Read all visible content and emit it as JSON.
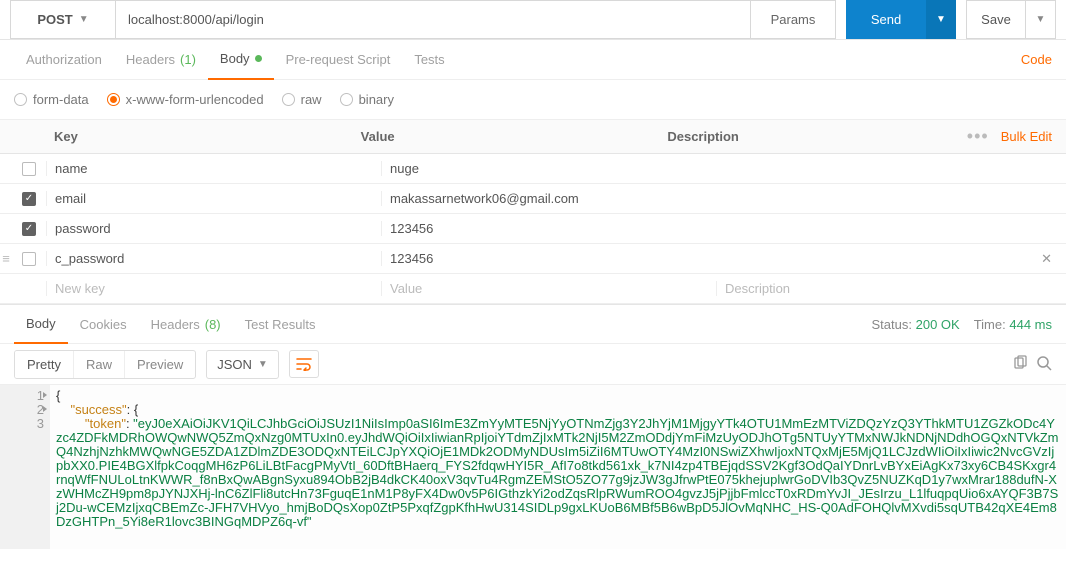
{
  "request": {
    "method": "POST",
    "url": "localhost:8000/api/login",
    "params_label": "Params",
    "send_label": "Send",
    "save_label": "Save"
  },
  "reqTabs": {
    "authorization": "Authorization",
    "headers": "Headers",
    "headers_count": "(1)",
    "body": "Body",
    "prerequest": "Pre-request Script",
    "tests": "Tests",
    "code": "Code"
  },
  "bodyType": {
    "formdata": "form-data",
    "urlencoded": "x-www-form-urlencoded",
    "raw": "raw",
    "binary": "binary"
  },
  "kvHeaders": {
    "key": "Key",
    "value": "Value",
    "description": "Description",
    "bulk": "Bulk Edit"
  },
  "rows": [
    {
      "checked": false,
      "key": "name",
      "value": "nuge",
      "desc": ""
    },
    {
      "checked": true,
      "key": "email",
      "value": "makassarnetwork06@gmail.com",
      "desc": ""
    },
    {
      "checked": true,
      "key": "password",
      "value": "123456",
      "desc": ""
    },
    {
      "checked": false,
      "key": "c_password",
      "value": "123456",
      "desc": "",
      "hover": true
    }
  ],
  "placeholders": {
    "key": "New key",
    "value": "Value",
    "desc": "Description"
  },
  "respTabs": {
    "body": "Body",
    "cookies": "Cookies",
    "headers": "Headers",
    "headers_count": "(8)",
    "tests": "Test Results"
  },
  "respMeta": {
    "status_label": "Status:",
    "status_value": "200 OK",
    "time_label": "Time:",
    "time_value": "444 ms"
  },
  "respView": {
    "pretty": "Pretty",
    "raw": "Raw",
    "preview": "Preview",
    "format": "JSON"
  },
  "json": {
    "line1": "{",
    "key_success": "\"success\"",
    "colon_brace": ": {",
    "key_token": "\"token\"",
    "colon": ": ",
    "token_value": "\"eyJ0eXAiOiJKV1QiLCJhbGciOiJSUzI1NiIsImp0aSI6ImE3ZmYyMTE5NjYyOTNmZjg3Y2JhYjM1MjgyYTk4OTU1MmEzMTViZDQzYzQ3YThkMTU1ZGZkODc4Yzc4ZDFkMDRhOWQwNWQ5ZmQxNzg0MTUxIn0.eyJhdWQiOiIxIiwianRpIjoiYTdmZjIxMTk2NjI5M2ZmODdjYmFiMzUyODJhOTg5NTUyYTMxNWJkNDNjNDdhOGQxNTVkZmQ4NzhjNzhkMWQwNGE5ZDA1ZDlmZDE3ODQxNTEiLCJpYXQiOjE1MDk2ODMyNDUsIm5iZiI6MTUwOTY4MzI0NSwiZXhwIjoxNTQxMjE5MjQ1LCJzdWIiOiIxIiwic2NvcGVzIjpbXX0.PIE4BGXlfpkCoqgMH6zP6LiLBtFacgPMyVtI_60DftBHaerq_FYS2fdqwHYI5R_AfI7o8tkd561xk_k7NI4zp4TBEjqdSSV2Kgf3OdQaIYDnrLvBYxEiAgKx73xy6CB4SKxgr4rnqWfFNULoLtnKWWR_f8nBxQwABgnSyxu894ObB2jB4dkCK40oxV3qvTu4RgmZEMStO5ZO77g9jzJW3gJfrwPtE075khejuplwrGoDVIb3QvZ5NUZKqD1y7wxMrar188dufN-XzWHMcZH9pm8pJYNJXHj-lnC6ZlFli8utcHn73FguqE1nM1P8yFX4Dw0v5P6IGthzkYi2odZqsRlpRWumROO4gvzJ5jPjjbFmlccT0xRDmYvJI_JEsIrzu_L1lfuqpqUio6xAYQF3B7Sj2Du-wCEMzIjxqCBEmZc-JFH7VHVyo_hmjBoDQsXop0ZtP5PxqfZgpKfhHwU314SIDLp9gxLKUoB6MBf5B6wBpD5JlOvMqNHC_HS-Q0AdFOHQlvMXvdi5sqUTB42qXE4Em8DzGHTPn_5Yi8eR1lovc3BINGqMDPZ6q-vf\""
  },
  "gutter": [
    "1",
    "2",
    "3"
  ]
}
